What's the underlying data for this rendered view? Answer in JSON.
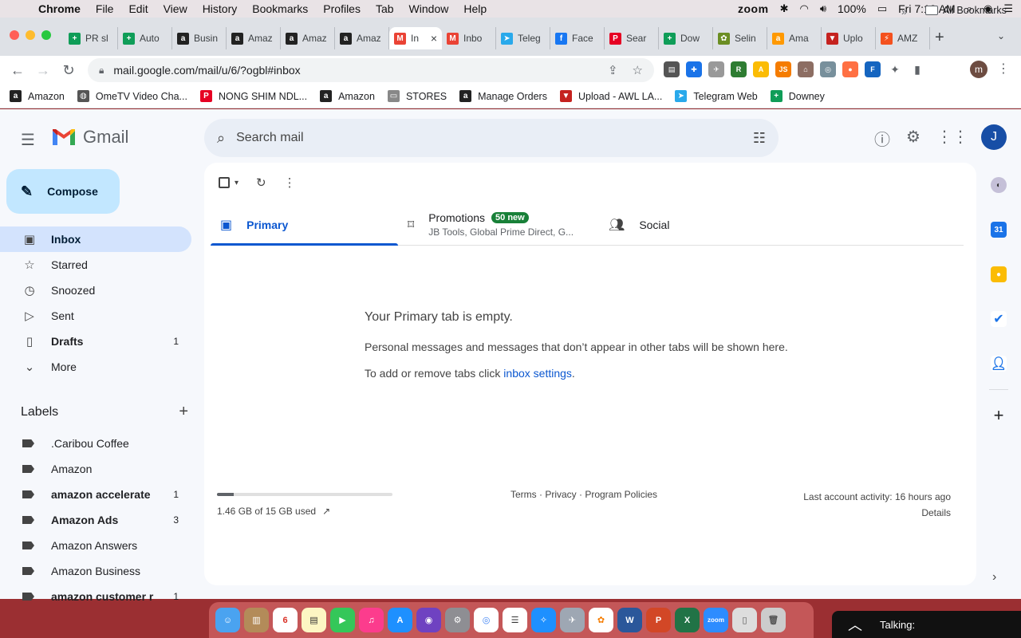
{
  "menubar": {
    "app": "Chrome",
    "items": [
      "File",
      "Edit",
      "View",
      "History",
      "Bookmarks",
      "Profiles",
      "Tab",
      "Window",
      "Help"
    ],
    "zoom": "zoom",
    "battery": "100%",
    "clock": "Fri 7:10 AM"
  },
  "tabs": [
    {
      "label": "PR sl",
      "color": "#0f9d58",
      "glyph": "+"
    },
    {
      "label": "Auto",
      "color": "#0f9d58",
      "glyph": "+"
    },
    {
      "label": "Busin",
      "color": "#222222",
      "glyph": "a"
    },
    {
      "label": "Amaz",
      "color": "#222222",
      "glyph": "a"
    },
    {
      "label": "Amaz",
      "color": "#222222",
      "glyph": "a"
    },
    {
      "label": "Amaz",
      "color": "#222222",
      "glyph": "a"
    },
    {
      "label": "In",
      "color": "#ea4335",
      "glyph": "M",
      "active": true
    },
    {
      "label": "Inbo",
      "color": "#ea4335",
      "glyph": "M"
    },
    {
      "label": "Teleg",
      "color": "#29a9eb",
      "glyph": "➤"
    },
    {
      "label": "Face",
      "color": "#1877f2",
      "glyph": "f"
    },
    {
      "label": "Sear",
      "color": "#e60023",
      "glyph": "P"
    },
    {
      "label": "Dow",
      "color": "#0f9d58",
      "glyph": "+"
    },
    {
      "label": "Selin",
      "color": "#6b8e23",
      "glyph": "✿"
    },
    {
      "label": "Ama",
      "color": "#ff9900",
      "glyph": "a"
    },
    {
      "label": "Uplo",
      "color": "#c5221f",
      "glyph": "▼"
    },
    {
      "label": "AMZ",
      "color": "#f4511e",
      "glyph": "⚡"
    }
  ],
  "toolbar": {
    "url": "mail.google.com/mail/u/6/?ogbl#inbox",
    "profile_initial": "m"
  },
  "bookmarks": [
    {
      "label": "Amazon",
      "color": "#222222",
      "glyph": "a"
    },
    {
      "label": "OmeTV Video Cha...",
      "color": "#555555",
      "glyph": "◍"
    },
    {
      "label": "NONG SHIM NDL...",
      "color": "#e60023",
      "glyph": "P"
    },
    {
      "label": "Amazon",
      "color": "#222222",
      "glyph": "a"
    },
    {
      "label": "STORES",
      "color": "#888888",
      "glyph": "▭"
    },
    {
      "label": "Manage Orders",
      "color": "#222222",
      "glyph": "a"
    },
    {
      "label": "Upload - AWL LA...",
      "color": "#c5221f",
      "glyph": "▼"
    },
    {
      "label": "Telegram Web",
      "color": "#29a9eb",
      "glyph": "➤"
    },
    {
      "label": "Downey",
      "color": "#0f9d58",
      "glyph": "+"
    }
  ],
  "bookmarks_all": "All Bookmarks",
  "gmail": {
    "brand": "Gmail",
    "search_placeholder": "Search mail",
    "account_initial": "J",
    "compose": "Compose",
    "nav": [
      {
        "label": "Inbox",
        "icon": "▣",
        "active": true,
        "bold": true,
        "count": ""
      },
      {
        "label": "Starred",
        "icon": "☆",
        "count": ""
      },
      {
        "label": "Snoozed",
        "icon": "◷",
        "count": ""
      },
      {
        "label": "Sent",
        "icon": "▷",
        "count": ""
      },
      {
        "label": "Drafts",
        "icon": "▯",
        "bold": true,
        "count": "1"
      },
      {
        "label": "More",
        "icon": "⌄",
        "count": ""
      }
    ],
    "labels_title": "Labels",
    "labels": [
      {
        "label": ".Caribou Coffee",
        "bold": false,
        "count": ""
      },
      {
        "label": "Amazon",
        "bold": false,
        "count": ""
      },
      {
        "label": "amazon accelerate",
        "bold": true,
        "count": "1"
      },
      {
        "label": "Amazon Ads",
        "bold": true,
        "count": "3"
      },
      {
        "label": "Amazon Answers",
        "bold": false,
        "count": ""
      },
      {
        "label": "Amazon Business",
        "bold": false,
        "count": ""
      },
      {
        "label": "amazon customer r",
        "bold": true,
        "count": "1"
      }
    ],
    "category_tabs": {
      "primary": "Primary",
      "promotions": "Promotions",
      "promotions_badge": "50 new",
      "promotions_senders": "JB Tools, Global Prime Direct, G...",
      "social": "Social"
    },
    "empty": {
      "title": "Your Primary tab is empty.",
      "body": "Personal messages and messages that don’t appear in other tabs will be shown here.",
      "settings_prefix": "To add or remove tabs click ",
      "settings_link": "inbox settings",
      "settings_suffix": "."
    },
    "storage": {
      "text": "1.46 GB of 15 GB used",
      "used_fraction": 0.0973
    },
    "footer": "Terms · Privacy · Program Policies",
    "activity": "Last account activity: 16 hours ago",
    "details": "Details"
  },
  "zoom_panel": {
    "talking": "Talking:"
  },
  "colors": {
    "accent": "#0b57d0",
    "compose_bg": "#c2e7ff",
    "active_nav": "#d3e3fd",
    "badge": "#188038",
    "desktop": "#9b2f32"
  }
}
